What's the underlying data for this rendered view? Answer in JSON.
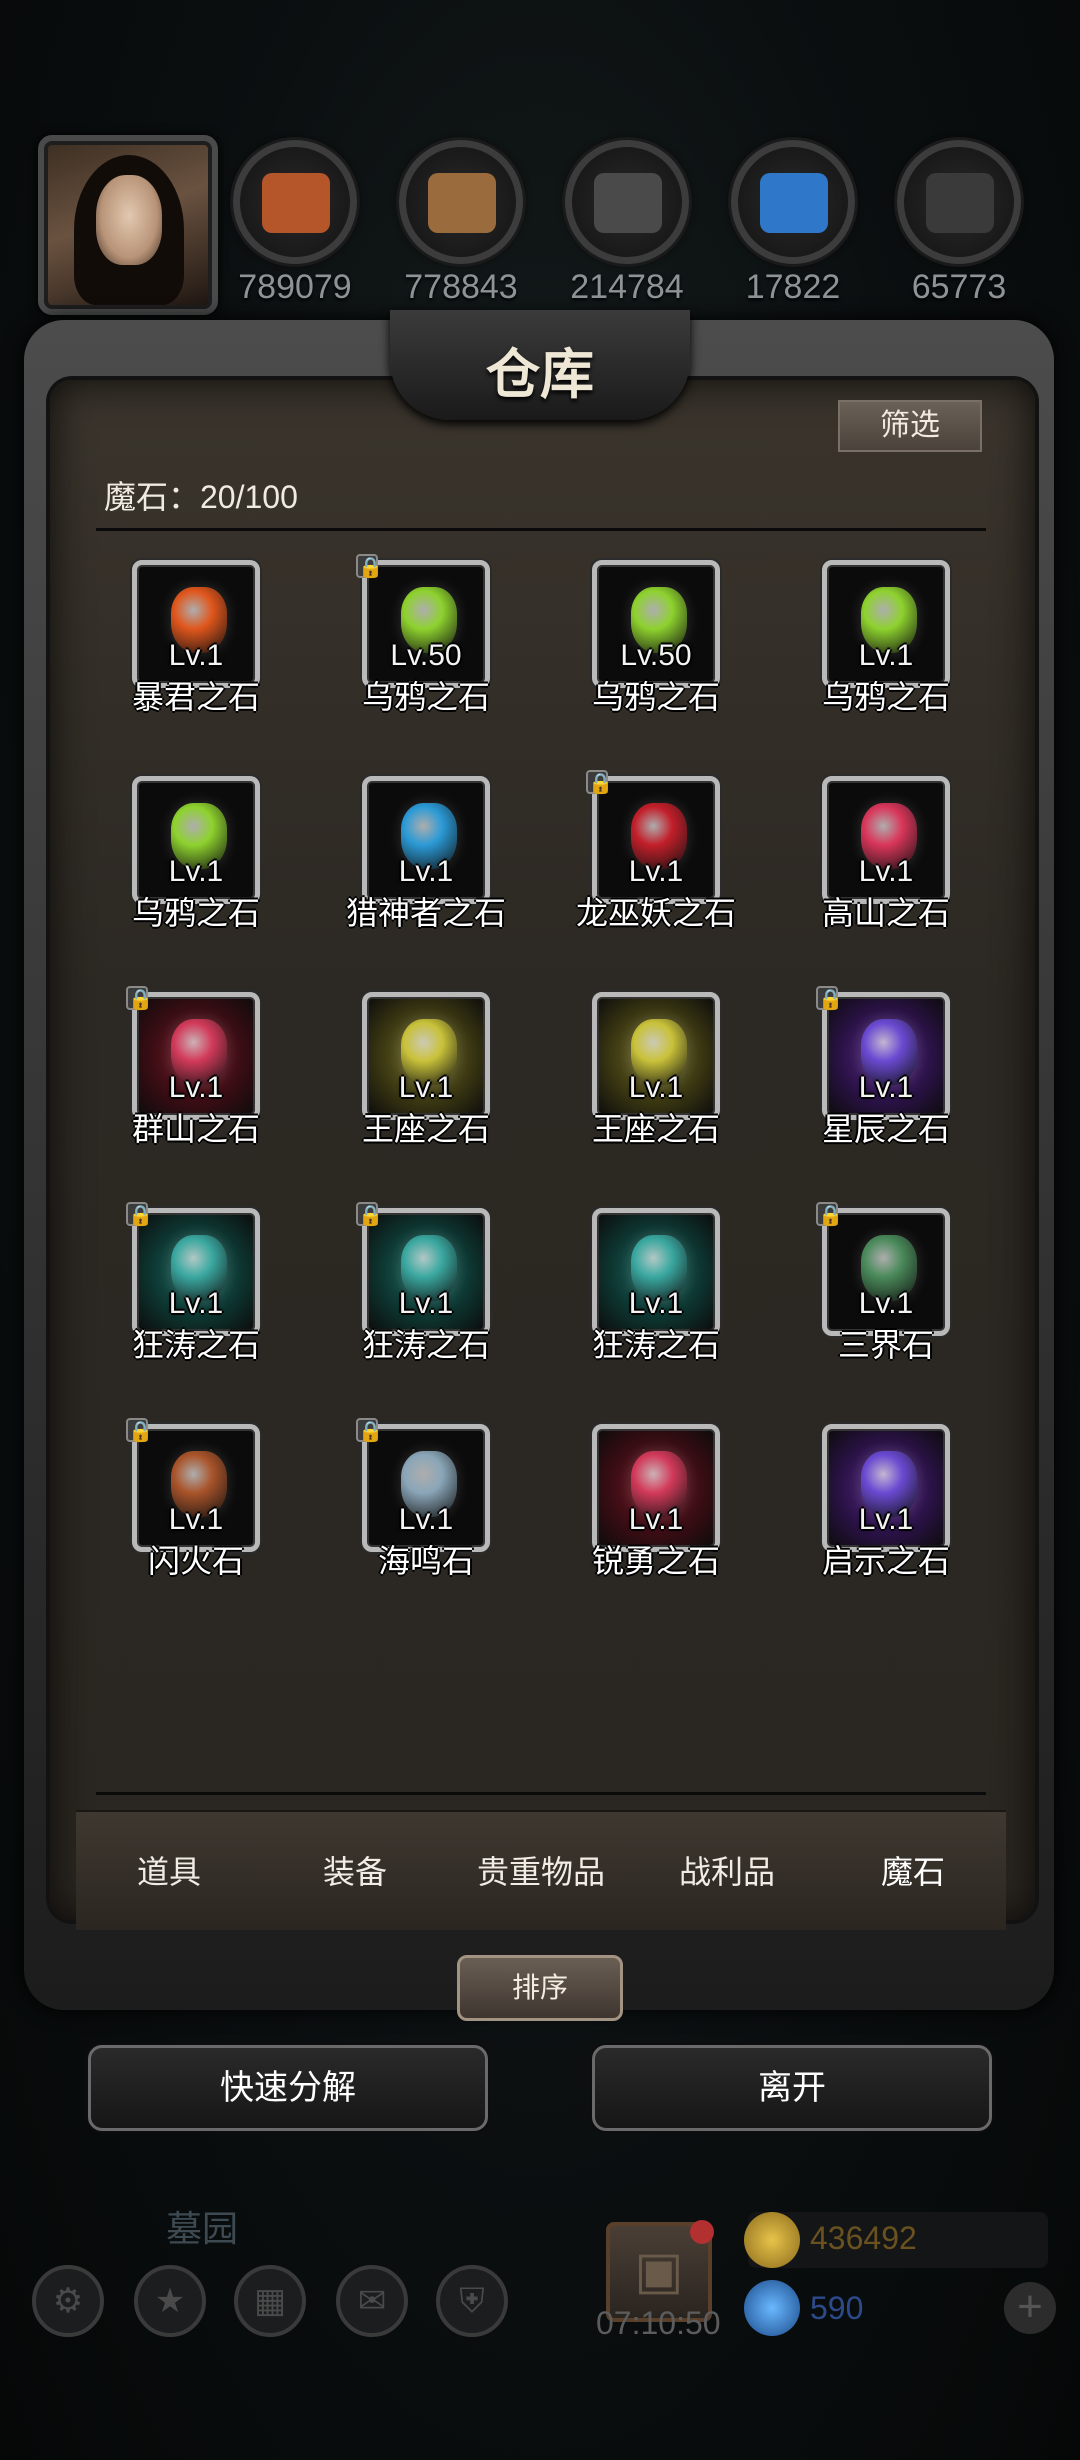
{
  "resources": [
    {
      "icon": "fruit-icon",
      "value": "789079",
      "color": "#b5552a"
    },
    {
      "icon": "wood-icon",
      "value": "778843",
      "color": "#9a6b3c"
    },
    {
      "icon": "iron-icon",
      "value": "214784",
      "color": "#4a4a4a"
    },
    {
      "icon": "crystal-icon",
      "value": "17822",
      "color": "#2e77c9"
    },
    {
      "icon": "stone-icon",
      "value": "65773",
      "color": "#3a3a3a"
    }
  ],
  "panel": {
    "title": "仓库",
    "filter_label": "筛选",
    "count_label": "魔石：20/100"
  },
  "items": [
    {
      "name": "暴君之石",
      "level": "Lv.1",
      "locked": false,
      "gem_color": "#e0561c",
      "glow": ""
    },
    {
      "name": "乌鸦之石",
      "level": "Lv.50",
      "locked": true,
      "gem_color": "#8ed22e",
      "glow": ""
    },
    {
      "name": "乌鸦之石",
      "level": "Lv.50",
      "locked": false,
      "gem_color": "#8ed22e",
      "glow": ""
    },
    {
      "name": "乌鸦之石",
      "level": "Lv.1",
      "locked": false,
      "gem_color": "#8ed22e",
      "glow": ""
    },
    {
      "name": "乌鸦之石",
      "level": "Lv.1",
      "locked": false,
      "gem_color": "#8ed22e",
      "glow": ""
    },
    {
      "name": "猎神者之石",
      "level": "Lv.1",
      "locked": false,
      "gem_color": "#2b9ad6",
      "glow": ""
    },
    {
      "name": "龙巫妖之石",
      "level": "Lv.1",
      "locked": true,
      "gem_color": "#c21f2a",
      "glow": ""
    },
    {
      "name": "高山之石",
      "level": "Lv.1",
      "locked": false,
      "gem_color": "#d9365a",
      "glow": ""
    },
    {
      "name": "群山之石",
      "level": "Lv.1",
      "locked": true,
      "gem_color": "#d23a5a",
      "glow": "glow-red"
    },
    {
      "name": "王座之石",
      "level": "Lv.1",
      "locked": false,
      "gem_color": "#c9c23a",
      "glow": "glow-yellow"
    },
    {
      "name": "王座之石",
      "level": "Lv.1",
      "locked": false,
      "gem_color": "#c9c23a",
      "glow": "glow-yellow"
    },
    {
      "name": "星辰之石",
      "level": "Lv.1",
      "locked": true,
      "gem_color": "#6a4ad2",
      "glow": "glow-purple"
    },
    {
      "name": "狂涛之石",
      "level": "Lv.1",
      "locked": true,
      "gem_color": "#3aa8a0",
      "glow": "glow-teal"
    },
    {
      "name": "狂涛之石",
      "level": "Lv.1",
      "locked": true,
      "gem_color": "#3aa8a0",
      "glow": "glow-teal"
    },
    {
      "name": "狂涛之石",
      "level": "Lv.1",
      "locked": false,
      "gem_color": "#3aa8a0",
      "glow": "glow-teal"
    },
    {
      "name": "三界石",
      "level": "Lv.1",
      "locked": true,
      "gem_color": "#4a8a5a",
      "glow": ""
    },
    {
      "name": "闪火石",
      "level": "Lv.1",
      "locked": true,
      "gem_color": "#a9542a",
      "glow": ""
    },
    {
      "name": "海鸣石",
      "level": "Lv.1",
      "locked": true,
      "gem_color": "#8aa6b8",
      "glow": ""
    },
    {
      "name": "锐勇之石",
      "level": "Lv.1",
      "locked": false,
      "gem_color": "#d23a5a",
      "glow": "glow-red"
    },
    {
      "name": "启示之石",
      "level": "Lv.1",
      "locked": false,
      "gem_color": "#6a4ad2",
      "glow": "glow-purple"
    }
  ],
  "tabs": [
    {
      "label": "道具",
      "active": false
    },
    {
      "label": "装备",
      "active": false
    },
    {
      "label": "贵重物品",
      "active": false
    },
    {
      "label": "战利品",
      "active": false
    },
    {
      "label": "魔石",
      "active": true
    }
  ],
  "actions": {
    "sort_label": "排序",
    "quick_decompose_label": "快速分解",
    "leave_label": "离开"
  },
  "background_hud": {
    "location_label": "墓园",
    "timer": "07:10:50",
    "gold": "436492",
    "gems": "590"
  }
}
